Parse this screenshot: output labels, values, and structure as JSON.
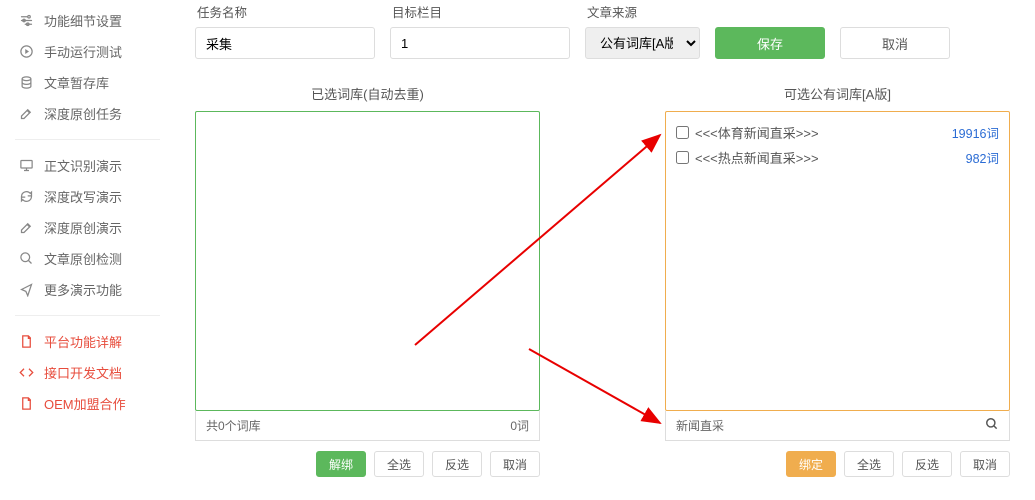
{
  "sidebar": {
    "group1": [
      {
        "icon": "sliders",
        "label": "功能细节设置"
      },
      {
        "icon": "play",
        "label": "手动运行测试"
      },
      {
        "icon": "database",
        "label": "文章暂存库"
      },
      {
        "icon": "edit",
        "label": "深度原创任务"
      }
    ],
    "group2": [
      {
        "icon": "monitor",
        "label": "正文识别演示"
      },
      {
        "icon": "refresh",
        "label": "深度改写演示"
      },
      {
        "icon": "edit",
        "label": "深度原创演示"
      },
      {
        "icon": "search",
        "label": "文章原创检测"
      },
      {
        "icon": "share",
        "label": "更多演示功能"
      }
    ],
    "group3": [
      {
        "icon": "doc",
        "label": "平台功能详解",
        "red": true
      },
      {
        "icon": "code",
        "label": "接口开发文档",
        "red": true
      },
      {
        "icon": "doc",
        "label": "OEM加盟合作",
        "red": true
      }
    ]
  },
  "form": {
    "task_name_label": "任务名称",
    "task_name_value": "采集",
    "target_col_label": "目标栏目",
    "target_col_value": "1",
    "source_label": "文章来源",
    "source_value": "公有词库[A版]",
    "save_label": "保存",
    "cancel_label": "取消"
  },
  "left_pane": {
    "title": "已选词库(自动去重)",
    "footer_left": "共0个词库",
    "footer_right": "0词",
    "actions": {
      "unbind": "解绑",
      "select_all": "全选",
      "invert": "反选",
      "cancel": "取消"
    }
  },
  "right_pane": {
    "title": "可选公有词库[A版]",
    "items": [
      {
        "label": "<<<体育新闻直采>>>",
        "count": "19916词"
      },
      {
        "label": "<<<热点新闻直采>>>",
        "count": "982词"
      }
    ],
    "search_value": "新闻直采",
    "actions": {
      "bind": "绑定",
      "select_all": "全选",
      "invert": "反选",
      "cancel": "取消"
    }
  }
}
